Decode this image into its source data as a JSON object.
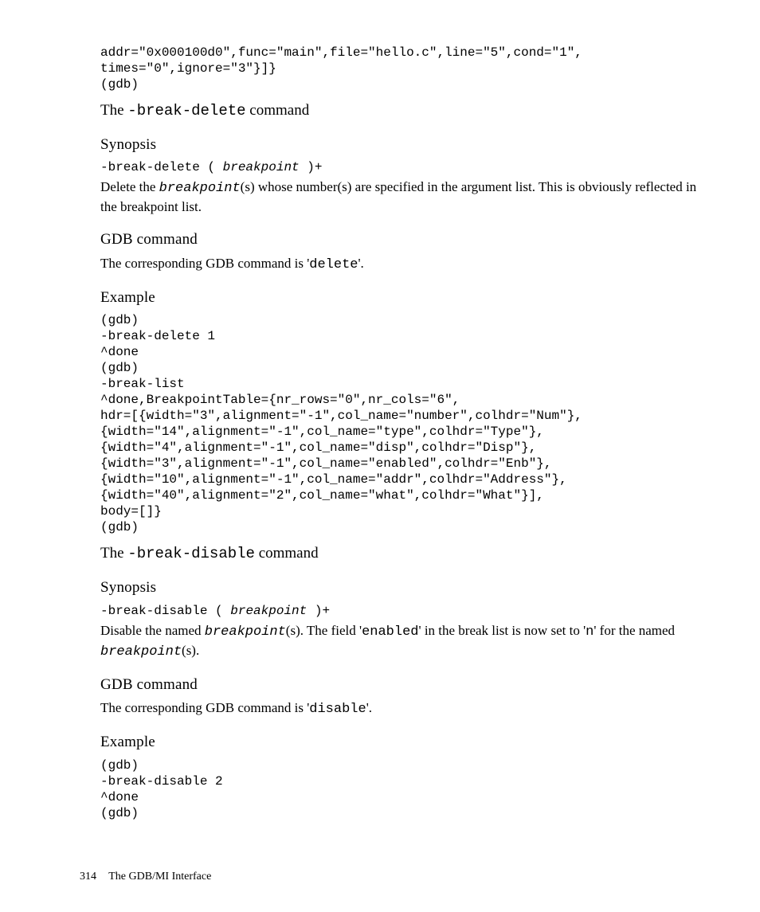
{
  "top_code": "addr=\"0x000100d0\",func=\"main\",file=\"hello.c\",line=\"5\",cond=\"1\",\ntimes=\"0\",ignore=\"3\"}]}\n(gdb)",
  "sect1": {
    "title_pre": "The ",
    "title_cmd": "-break-delete",
    "title_post": " command",
    "synopsis_h": "Synopsis",
    "synopsis_code_pre": "-break-delete ( ",
    "synopsis_code_arg": "breakpoint",
    "synopsis_code_post": " )+",
    "desc_pre": "Delete the ",
    "desc_arg": "breakpoint",
    "desc_post": "(s) whose number(s) are specified in the argument list. This is obviously reflected in the breakpoint list.",
    "gdb_h": "GDB command",
    "gdb_desc_pre": "The corresponding GDB command is '",
    "gdb_desc_cmd": "delete",
    "gdb_desc_post": "'.",
    "example_h": "Example",
    "example_code": "(gdb)\n-break-delete 1\n^done\n(gdb)\n-break-list\n^done,BreakpointTable={nr_rows=\"0\",nr_cols=\"6\",\nhdr=[{width=\"3\",alignment=\"-1\",col_name=\"number\",colhdr=\"Num\"},\n{width=\"14\",alignment=\"-1\",col_name=\"type\",colhdr=\"Type\"},\n{width=\"4\",alignment=\"-1\",col_name=\"disp\",colhdr=\"Disp\"},\n{width=\"3\",alignment=\"-1\",col_name=\"enabled\",colhdr=\"Enb\"},\n{width=\"10\",alignment=\"-1\",col_name=\"addr\",colhdr=\"Address\"},\n{width=\"40\",alignment=\"2\",col_name=\"what\",colhdr=\"What\"}],\nbody=[]}\n(gdb)"
  },
  "sect2": {
    "title_pre": "The ",
    "title_cmd": "-break-disable",
    "title_post": " command",
    "synopsis_h": "Synopsis",
    "synopsis_code_pre": "-break-disable ( ",
    "synopsis_code_arg": "breakpoint",
    "synopsis_code_post": " )+",
    "desc_pre": "Disable the named ",
    "desc_arg1": "breakpoint",
    "desc_mid1": "(s). The field '",
    "desc_field": "enabled",
    "desc_mid2": "' in the break list is now set to '",
    "desc_n": "n",
    "desc_mid3": "' for the named ",
    "desc_arg2": "breakpoint",
    "desc_post": "(s).",
    "gdb_h": "GDB command",
    "gdb_desc_pre": "The corresponding GDB command is '",
    "gdb_desc_cmd": "disable",
    "gdb_desc_post": "'.",
    "example_h": "Example",
    "example_code": "(gdb)\n-break-disable 2\n^done\n(gdb)"
  },
  "footer": {
    "page": "314",
    "title_pre": "The ",
    "title_sc": "GDB/MI",
    "title_post": " Interface"
  }
}
